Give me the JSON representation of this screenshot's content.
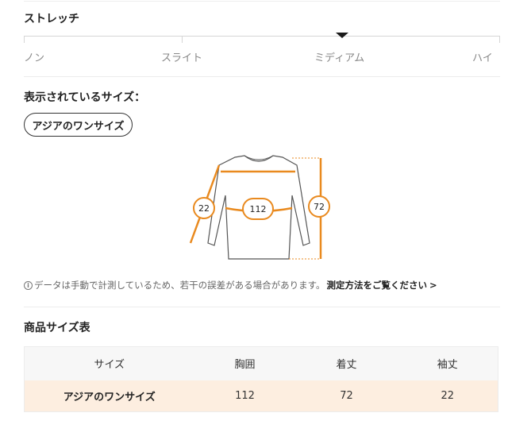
{
  "stretch": {
    "title": "ストレッチ",
    "levels": [
      "ノン",
      "スライト",
      "ミディアム",
      "ハイ"
    ],
    "selected": "ミディアム"
  },
  "size_display": {
    "title": "表示されているサイズ：",
    "chip": "アジアのワンサイズ"
  },
  "diagram": {
    "sleeve": "22",
    "chest": "112",
    "length": "72",
    "accent_color": "#e98a1f"
  },
  "note": {
    "icon": "info-icon",
    "text": "データは手動で計測しているため、若干の誤差がある場合があります。",
    "link": "測定方法をご覧ください",
    "chevron": ">"
  },
  "size_chart": {
    "title": "商品サイズ表",
    "headers": [
      "サイズ",
      "胸囲",
      "着丈",
      "袖丈"
    ],
    "row": [
      "アジアのワンサイズ",
      "112",
      "72",
      "22"
    ],
    "row_bg": "#fdeee0"
  }
}
